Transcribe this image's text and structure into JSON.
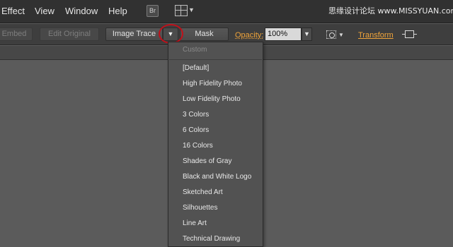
{
  "menubar": {
    "items": [
      "Effect",
      "View",
      "Window",
      "Help"
    ],
    "bridge_icon_label": "Br",
    "watermark": "思缘设计论坛 www.MISSYUAN.com"
  },
  "controlbar": {
    "embed_label": "Embed",
    "edit_original_label": "Edit Original",
    "image_trace_label": "Image Trace",
    "mask_label": "Mask",
    "opacity_label": "Opacity:",
    "opacity_value": "100%",
    "transform_label": "Transform"
  },
  "dropdown": {
    "header": "Custom",
    "items": [
      "[Default]",
      "High Fidelity Photo",
      "Low Fidelity Photo",
      "3 Colors",
      "6 Colors",
      "16 Colors",
      "Shades of Gray",
      "Black and White Logo",
      "Sketched Art",
      "Silhouettes",
      "Line Art",
      "Technical Drawing"
    ]
  },
  "colors": {
    "accent_link": "#f0a43a",
    "highlight_circle": "#c0101a"
  },
  "icons": [
    "bridge-icon",
    "workspace-switcher-icon",
    "chevron-down-icon",
    "align-icon",
    "isolate-icon"
  ]
}
